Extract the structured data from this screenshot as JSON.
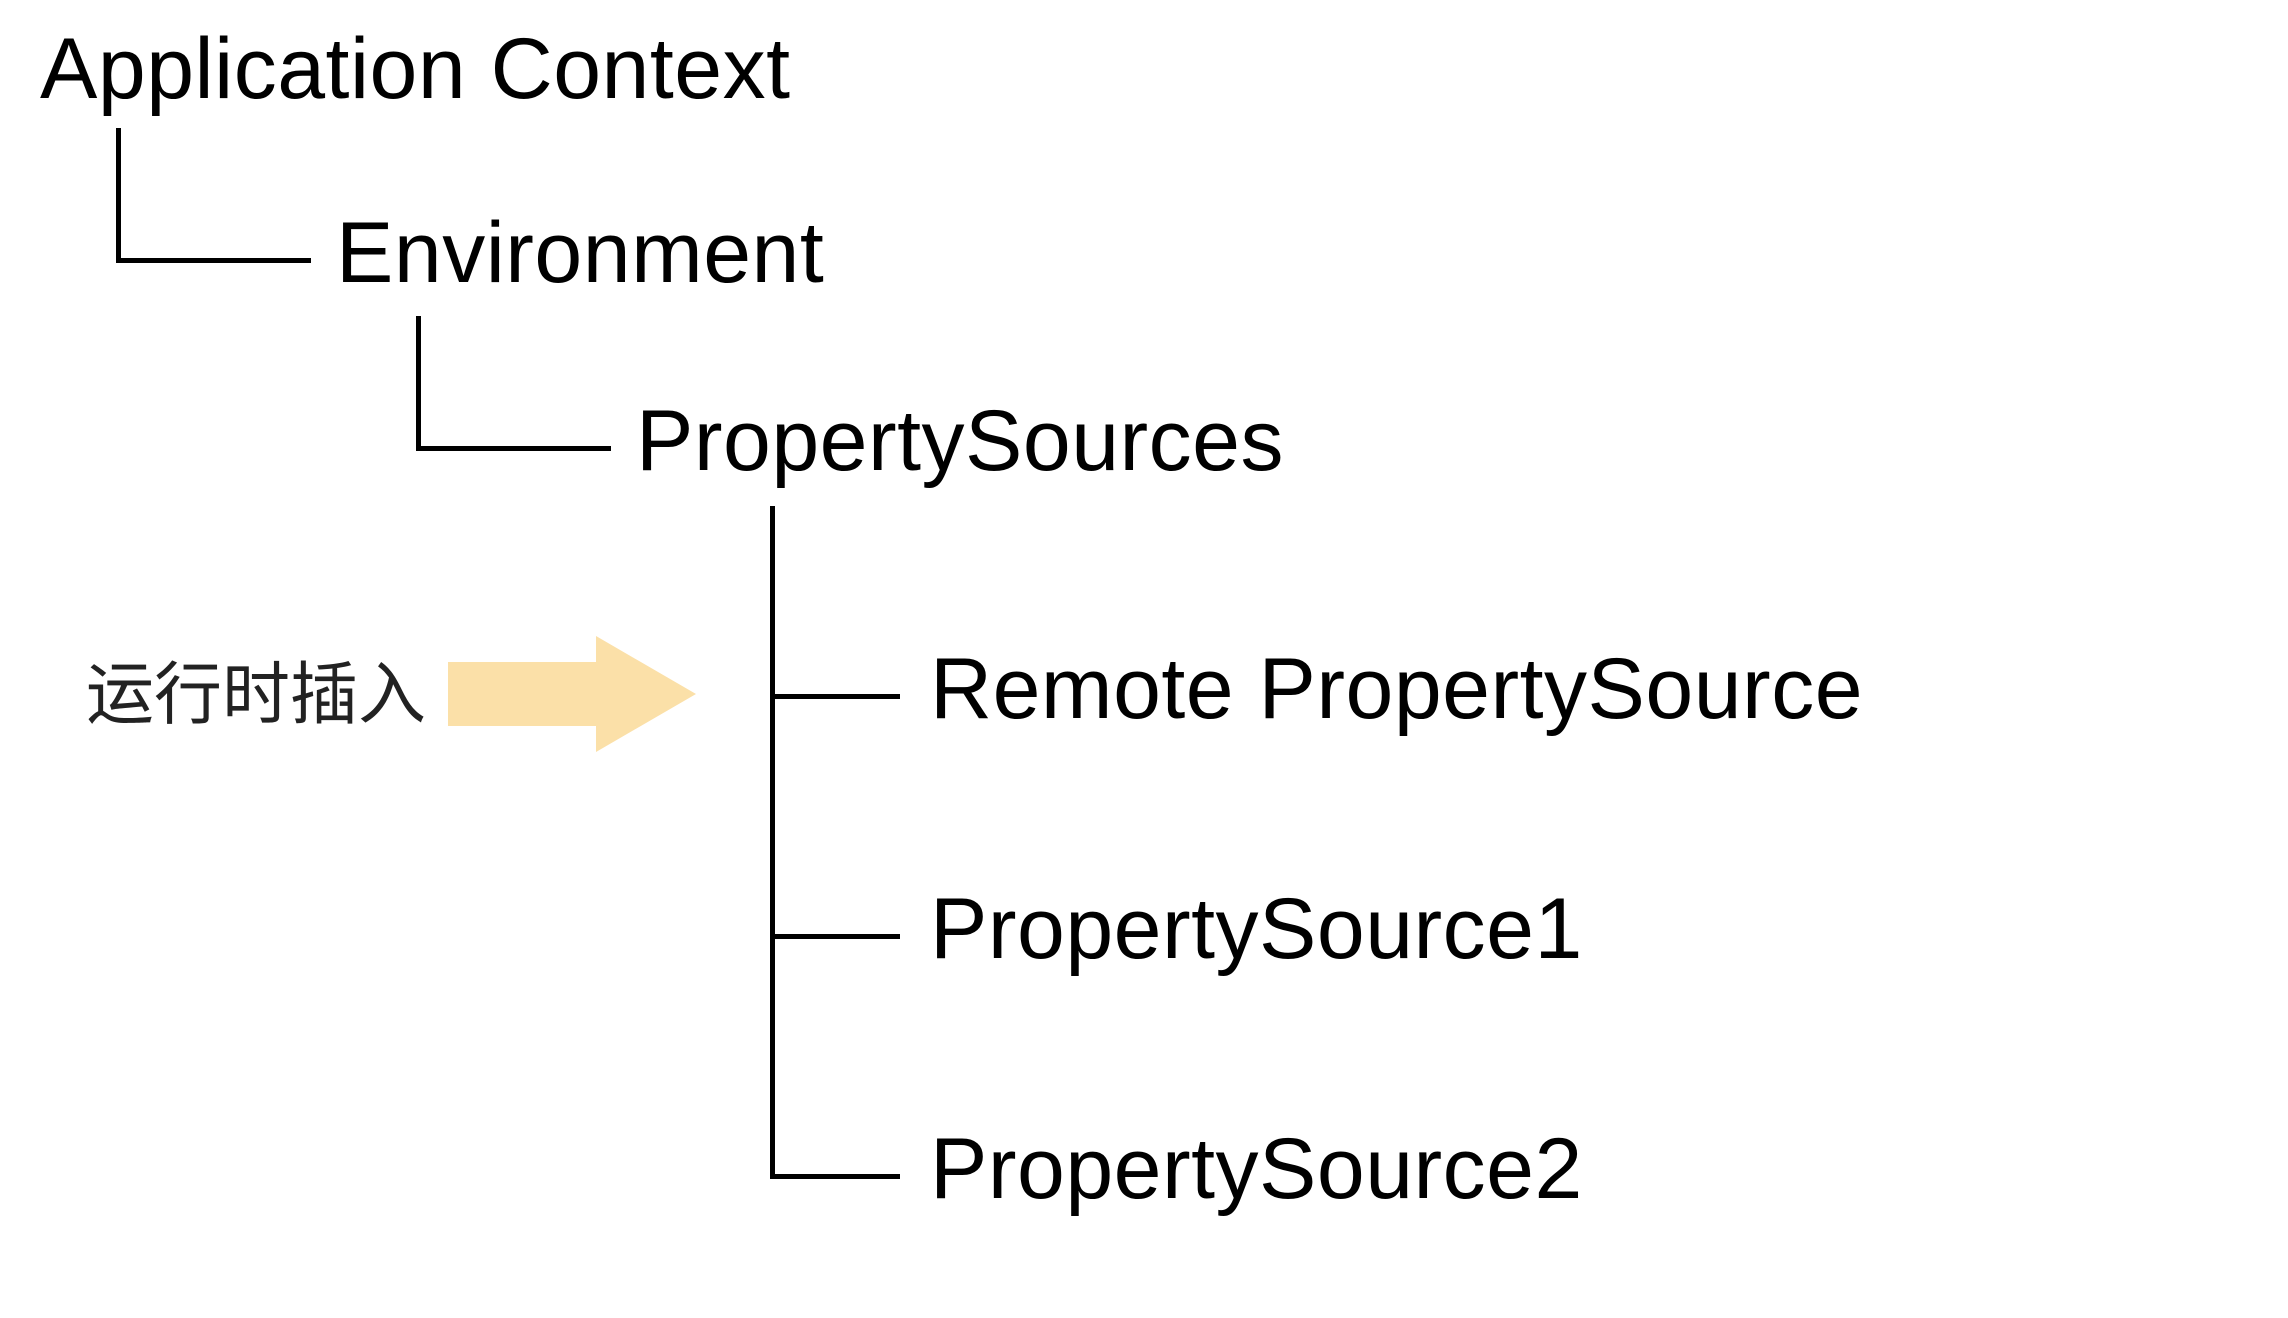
{
  "nodes": {
    "root": "Application Context",
    "environment": "Environment",
    "propertySources": "PropertySources",
    "remote": "Remote PropertySource",
    "ps1": "PropertySource1",
    "ps2": "PropertySource2"
  },
  "annotation": {
    "insertAtRuntime": "运行时插入"
  },
  "colors": {
    "line": "#000000",
    "arrow": "#fbe0a8",
    "text": "#000000"
  }
}
